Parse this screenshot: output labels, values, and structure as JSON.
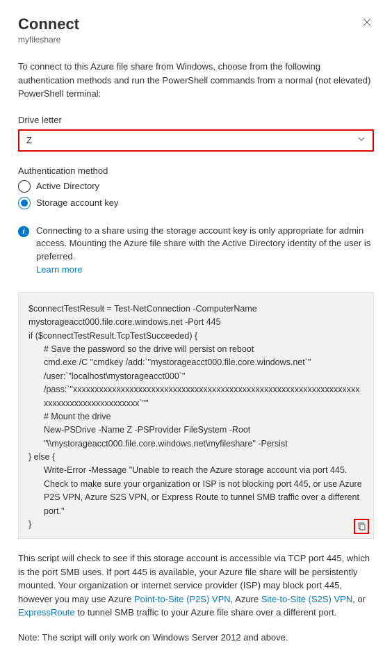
{
  "header": {
    "title": "Connect",
    "subtitle": "myfileshare"
  },
  "intro": "To connect to this Azure file share from Windows, choose from the following authentication methods and run the PowerShell commands from a normal (not elevated) PowerShell terminal:",
  "driveLetter": {
    "label": "Drive letter",
    "value": "Z"
  },
  "authMethod": {
    "label": "Authentication method",
    "options": {
      "ad": "Active Directory",
      "key": "Storage account key"
    },
    "selected": "key"
  },
  "info": {
    "text": "Connecting to a share using the storage account key is only appropriate for admin access. Mounting the Azure file share with the Active Directory identity of the user is preferred.",
    "learnMore": "Learn more"
  },
  "script": {
    "l1": "$connectTestResult = Test-NetConnection -ComputerName mystorageacct000.file.core.windows.net -Port 445",
    "l2": "if ($connectTestResult.TcpTestSucceeded) {",
    "l3": "# Save the password so the drive will persist on reboot",
    "l4": "cmd.exe /C \"cmdkey /add:`\"mystorageacct000.file.core.windows.net`\" /user:`\"localhost\\mystorageacct000`\" /pass:`\"xxxxxxxxxxxxxxxxxxxxxxxxxxxxxxxxxxxxxxxxxxxxxxxxxxxxxxxxxxxxxxxxxxxxxxxxxxxxxxxxxxxxxxxx`\"\"",
    "l5": "# Mount the drive",
    "l6": "New-PSDrive -Name Z -PSProvider FileSystem -Root \"\\\\mystorageacct000.file.core.windows.net\\myfileshare\" -Persist",
    "l7": "} else {",
    "l8": "Write-Error -Message \"Unable to reach the Azure storage account via port 445. Check to make sure your organization or ISP is not blocking port 445, or use Azure P2S VPN, Azure S2S VPN, or Express Route to tunnel SMB traffic over a different port.\"",
    "l9": "}"
  },
  "footer": {
    "p1a": "This script will check to see if this storage account is accessible via TCP port 445, which is the port SMB uses. If port 445 is available, your Azure file share will be persistently mounted. Your organization or internet service provider (ISP) may block port 445, however you may use Azure ",
    "link1": "Point-to-Site (P2S) VPN",
    "p1b": ", Azure ",
    "link2": "Site-to-Site (S2S) VPN",
    "p1c": ", or ",
    "link3": "ExpressRoute",
    "p1d": " to tunnel SMB traffic to your Azure file share over a different port.",
    "p2": "Note: The script will only work on Windows Server 2012 and above."
  }
}
